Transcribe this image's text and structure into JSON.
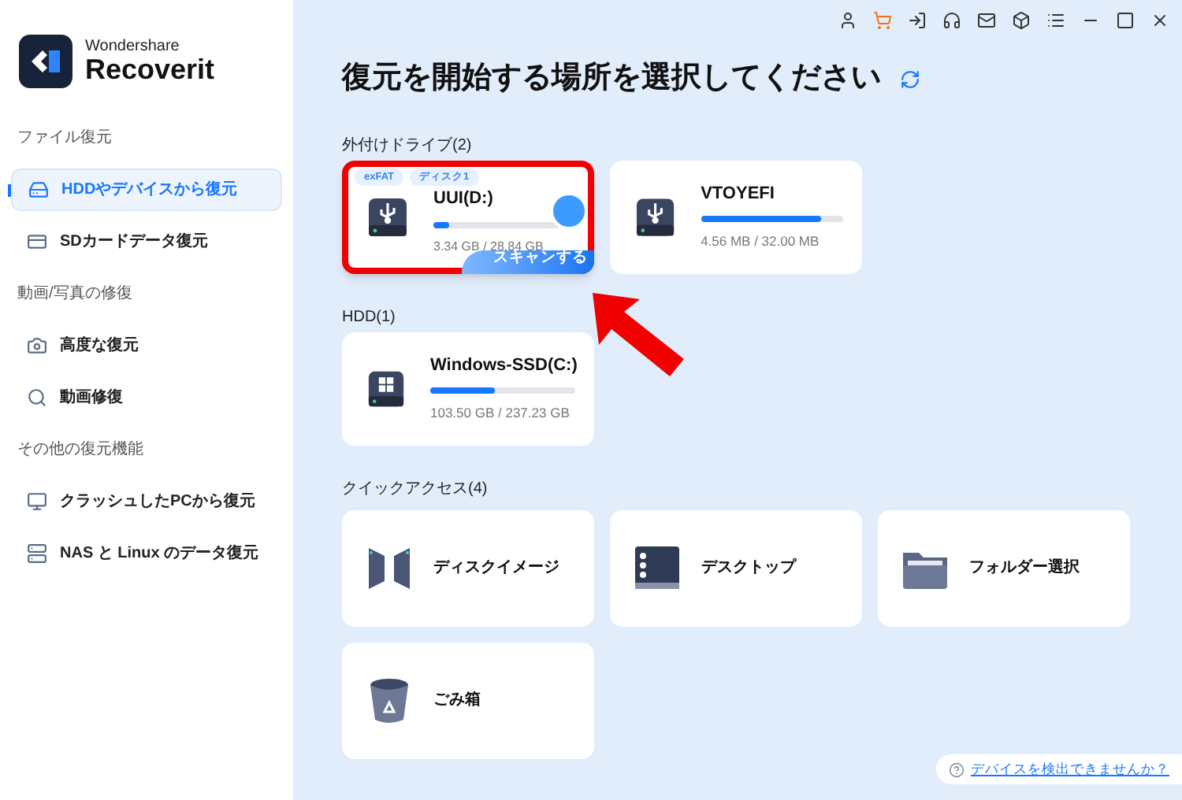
{
  "logo": {
    "brand": "Wondershare",
    "product": "Recoverit"
  },
  "sidebar": [
    {
      "heading": "ファイル復元",
      "items": [
        {
          "label": "HDDやデバイスから復元",
          "kind": "drive",
          "selected": true
        },
        {
          "label": "SDカードデータ復元",
          "kind": "sd",
          "selected": false
        }
      ]
    },
    {
      "heading": "動画/写真の修復",
      "items": [
        {
          "label": "高度な復元",
          "kind": "camera",
          "selected": false
        },
        {
          "label": "動画修復",
          "kind": "repair",
          "selected": false
        }
      ]
    },
    {
      "heading": "その他の復元機能",
      "items": [
        {
          "label": "クラッシュしたPCから復元",
          "kind": "monitor",
          "selected": false
        },
        {
          "label": "NAS と Linux のデータ復元",
          "kind": "nas",
          "selected": false
        }
      ]
    }
  ],
  "title": "復元を開始する場所を選択してください",
  "sections": [
    {
      "heading": "外付けドライブ(2)",
      "drives": [
        {
          "kind": "usb",
          "name": "UUI(D:)",
          "usage": "3.34 GB / 28.84 GB",
          "level": 0.12,
          "hovered": true,
          "highlighted": true,
          "tags": [
            "exFAT",
            "ディスク1"
          ],
          "scan_label": "スキャンする"
        },
        {
          "kind": "usb",
          "name": "VTOYEFI",
          "usage": "4.56 MB / 32.00 MB",
          "level": 0.85,
          "hovered": false,
          "highlighted": false
        }
      ]
    },
    {
      "heading": "HDD(1)",
      "drives": [
        {
          "kind": "windows",
          "name": "Windows-SSD(C:)",
          "usage": "103.50 GB / 237.23 GB",
          "level": 0.45,
          "hovered": false,
          "highlighted": false
        }
      ]
    }
  ],
  "quick_access": {
    "heading": "クイックアクセス(4)",
    "items": [
      {
        "kind": "disk_image",
        "label": "ディスクイメージ"
      },
      {
        "kind": "desktop",
        "label": "デスクトップ"
      },
      {
        "kind": "folder",
        "label": "フォルダー選択"
      },
      {
        "kind": "trash",
        "label": "ごみ箱"
      }
    ]
  },
  "help_link": "デバイスを検出できませんか？"
}
